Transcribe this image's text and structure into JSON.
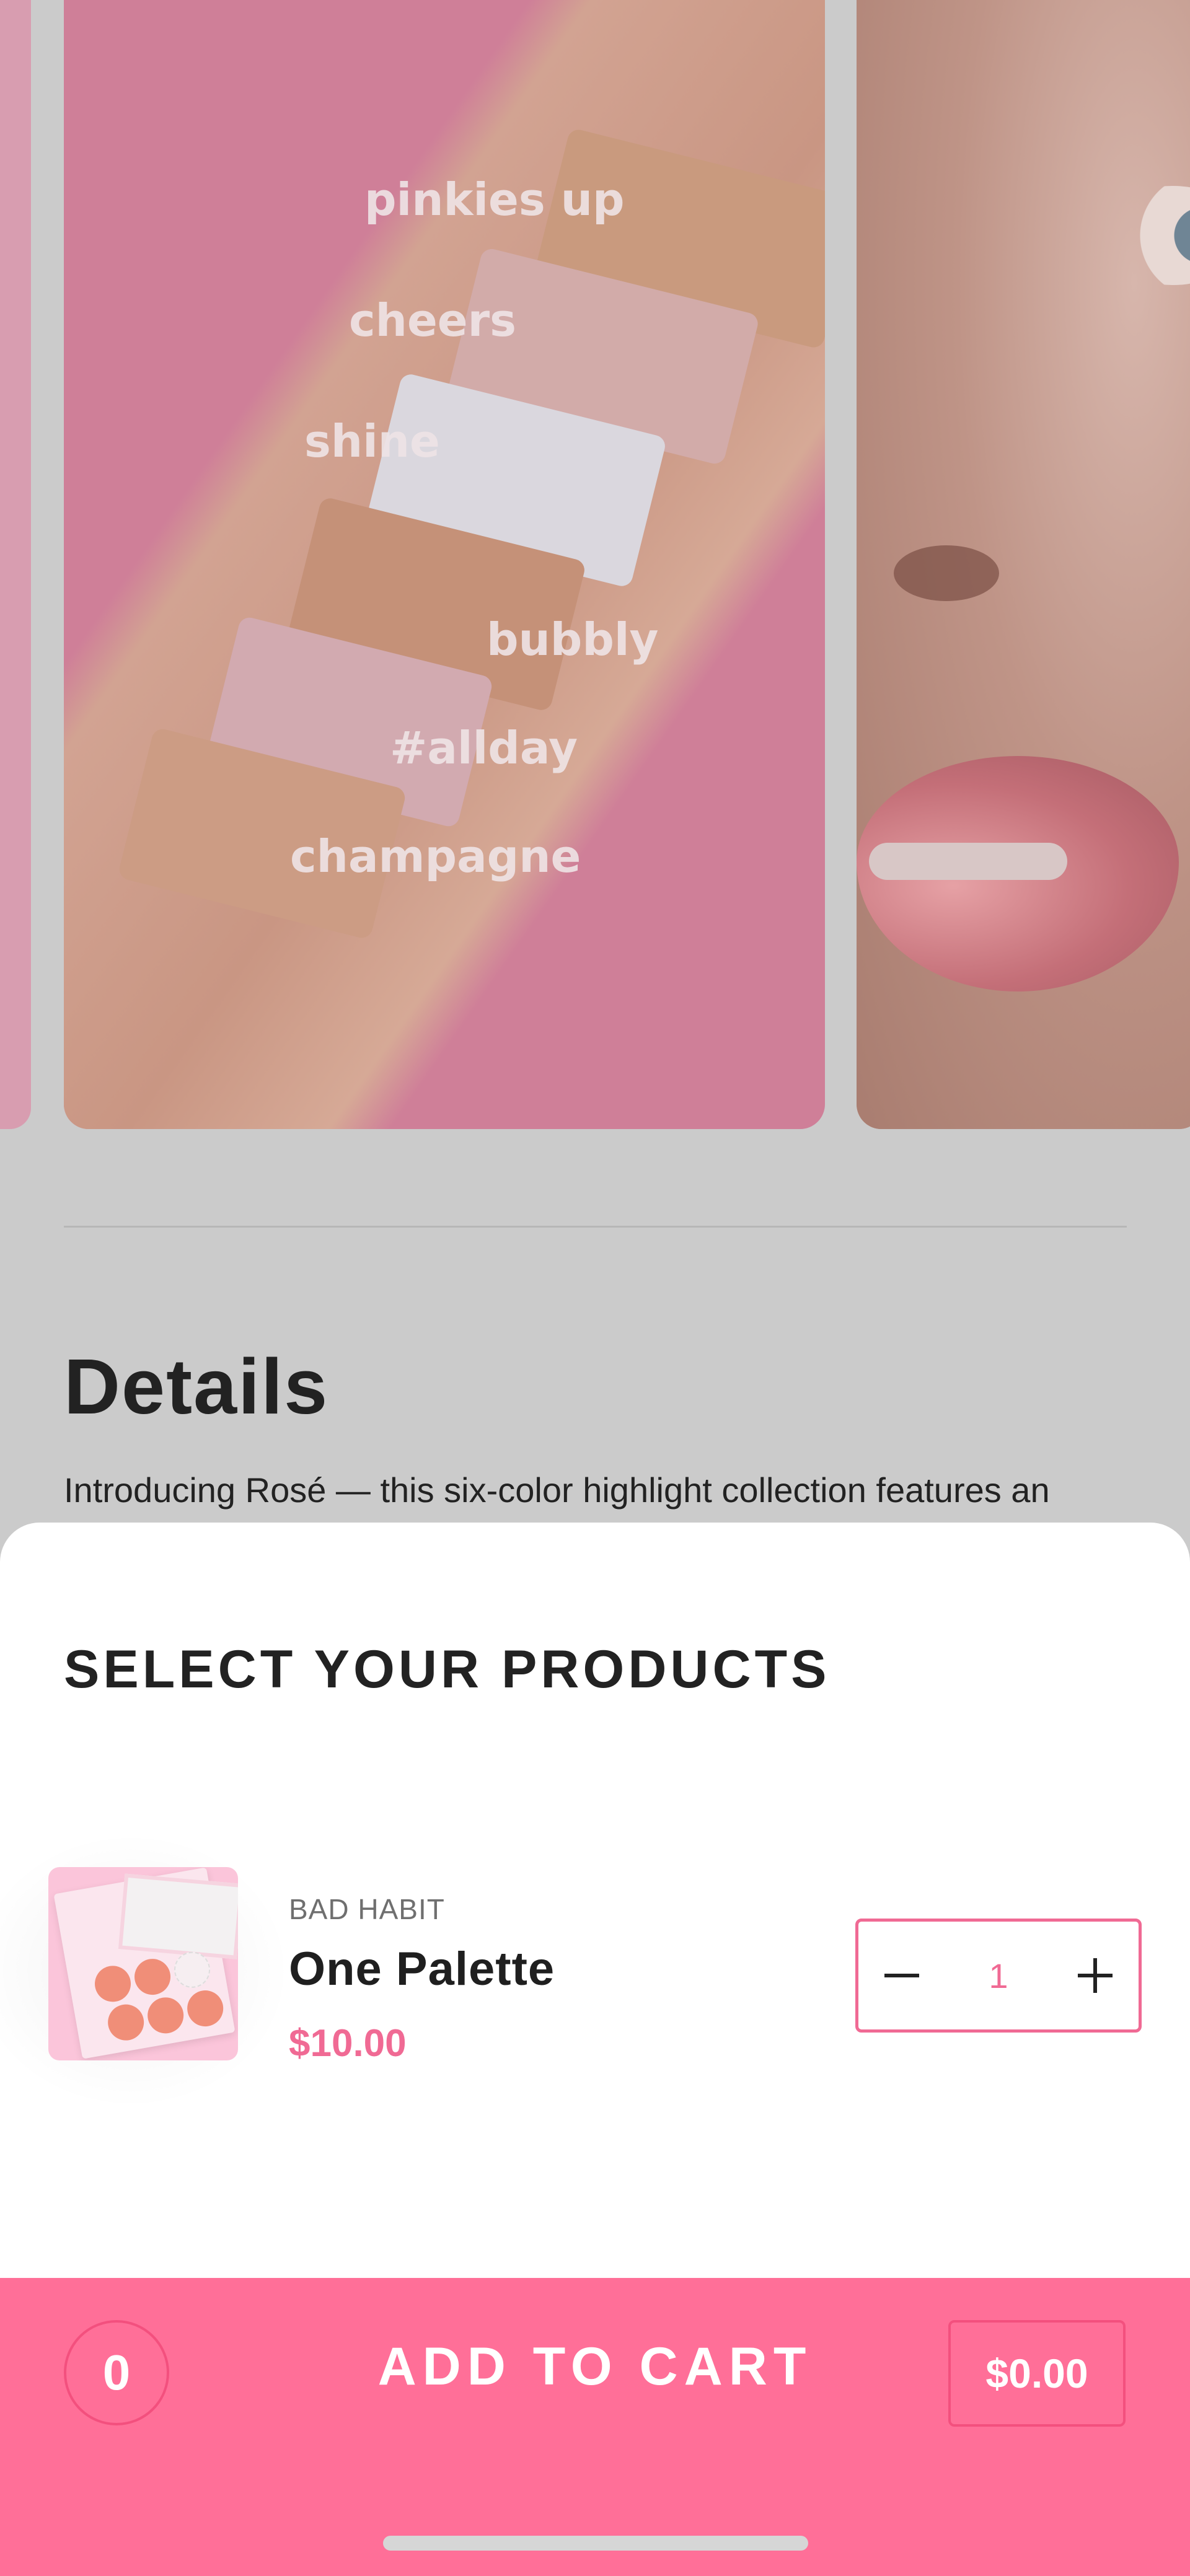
{
  "gallery": {
    "swatch_labels": [
      "pinkies up",
      "cheers",
      "shine",
      "bubbly",
      "#allday",
      "champagne"
    ]
  },
  "details": {
    "title": "Details",
    "text": "Introducing Rosé — this six-color highlight collection features an"
  },
  "sheet": {
    "title": "SELECT YOUR PRODUCTS",
    "product": {
      "brand": "BAD HABIT",
      "name": "One Palette",
      "price": "$10.00",
      "quantity": "1"
    }
  },
  "cart": {
    "count": "0",
    "label": "ADD TO CART",
    "total": "$0.00"
  },
  "colors": {
    "accent": "#ff6f98",
    "price": "#f06a94"
  }
}
